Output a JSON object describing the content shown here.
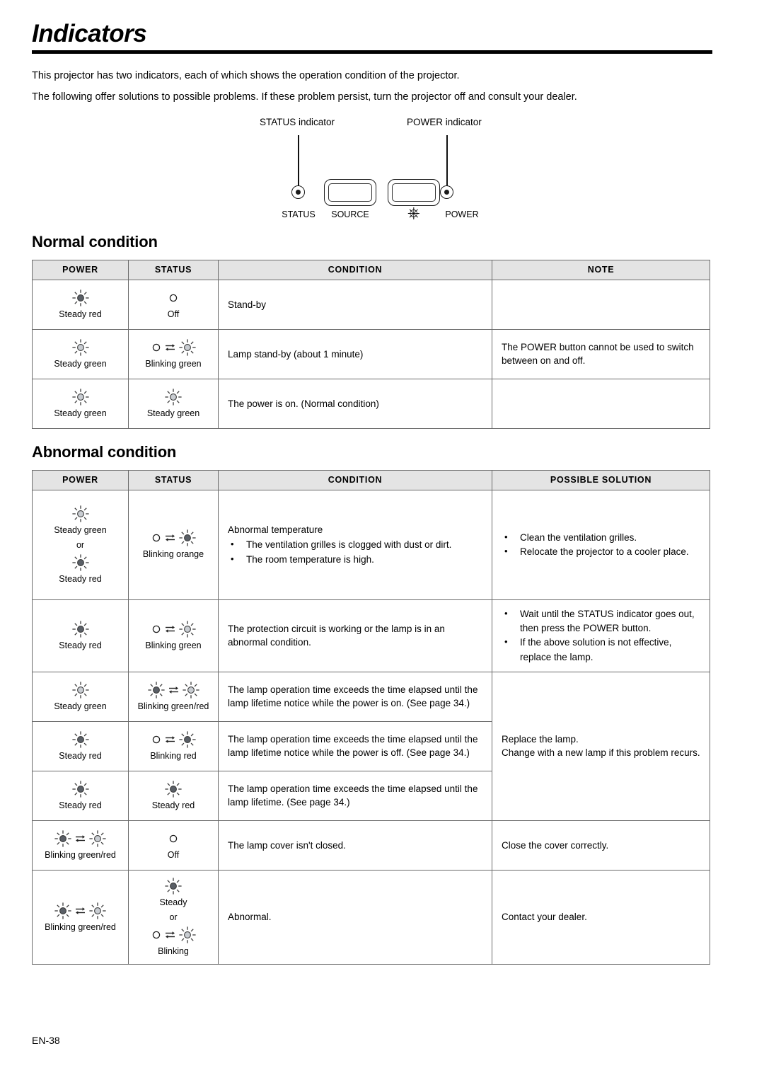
{
  "page": {
    "title": "Indicators",
    "footer": "EN-38",
    "intro": [
      "This projector has two indicators, each of which shows the operation condition of the projector.",
      "The following offer solutions to possible problems. If these problem persist, turn the projector off and consult your dealer."
    ]
  },
  "diagram": {
    "status_callout": "STATUS indicator",
    "power_callout": "POWER indicator",
    "captions": {
      "status": "STATUS",
      "source": "SOURCE",
      "power": "POWER"
    }
  },
  "normal": {
    "heading": "Normal condition",
    "headers": [
      "POWER",
      "STATUS",
      "CONDITION",
      "NOTE"
    ],
    "rows": [
      {
        "power": {
          "icon": "steady-red",
          "label": "Steady red"
        },
        "status": {
          "icon": "off",
          "label": "Off"
        },
        "condition": "Stand-by",
        "note": ""
      },
      {
        "power": {
          "icon": "steady-green",
          "label": "Steady green"
        },
        "status": {
          "icon": "blinking-green",
          "label": "Blinking green"
        },
        "condition": "Lamp stand-by (about 1 minute)",
        "note": "The POWER button cannot be used to switch between on and off."
      },
      {
        "power": {
          "icon": "steady-green",
          "label": "Steady green"
        },
        "status": {
          "icon": "steady-green",
          "label": "Steady green"
        },
        "condition": "The power is on. (Normal condition)",
        "note": ""
      }
    ]
  },
  "abnormal": {
    "heading": "Abnormal condition",
    "headers": [
      "POWER",
      "STATUS",
      "CONDITION",
      "POSSIBLE SOLUTION"
    ],
    "rows": [
      {
        "power_multi": [
          {
            "icon": "steady-green",
            "label": "Steady green"
          },
          {
            "or": "or"
          },
          {
            "icon": "steady-red",
            "label": "Steady red"
          }
        ],
        "status": {
          "icon": "blinking-orange",
          "label": "Blinking orange"
        },
        "condition_title": "Abnormal temperature",
        "condition_bullets": [
          "The ventilation grilles is clogged with dust or dirt.",
          "The room temperature is high."
        ],
        "solution_bullets": [
          "Clean the ventilation grilles.",
          "Relocate the projector to a cooler place."
        ]
      },
      {
        "power": {
          "icon": "steady-red",
          "label": "Steady red"
        },
        "status": {
          "icon": "blinking-green",
          "label": "Blinking green"
        },
        "condition": "The protection circuit is working or the lamp is in an abnormal condition.",
        "solution_bullets": [
          "Wait until the STATUS indicator goes out, then press the POWER button.",
          "If the above solution is not effective, replace the lamp."
        ]
      },
      {
        "power": {
          "icon": "steady-green",
          "label": "Steady green"
        },
        "status": {
          "icon": "blinking-green-red",
          "label": "Blinking green/red"
        },
        "condition": "The lamp operation time exceeds the time elapsed until the lamp lifetime notice while the power is on. (See page 34.)",
        "solution_rowspan": [
          "Replace the lamp.",
          "Change with a new lamp if this problem recurs."
        ]
      },
      {
        "power": {
          "icon": "steady-red",
          "label": "Steady red"
        },
        "status": {
          "icon": "blinking-red",
          "label": "Blinking red"
        },
        "condition": "The lamp operation time exceeds the time elapsed until the lamp lifetime notice while the power is off. (See page 34.)"
      },
      {
        "power": {
          "icon": "steady-red",
          "label": "Steady red"
        },
        "status": {
          "icon": "steady-red",
          "label": "Steady red"
        },
        "condition": "The lamp operation time exceeds the time elapsed until the lamp lifetime. (See page 34.)"
      },
      {
        "power": {
          "icon": "blinking-green-red",
          "label": "Blinking green/red"
        },
        "status": {
          "icon": "off",
          "label": "Off"
        },
        "condition": "The lamp cover isn't closed.",
        "solution": "Close the cover correctly."
      },
      {
        "power": {
          "icon": "blinking-green-red",
          "label": "Blinking green/red"
        },
        "status_multi": [
          {
            "icon": "steady-red",
            "label": "Steady"
          },
          {
            "or": "or"
          },
          {
            "icon": "blinking-green",
            "label": "Blinking"
          }
        ],
        "condition": "Abnormal.",
        "solution": "Contact your dealer."
      }
    ]
  }
}
